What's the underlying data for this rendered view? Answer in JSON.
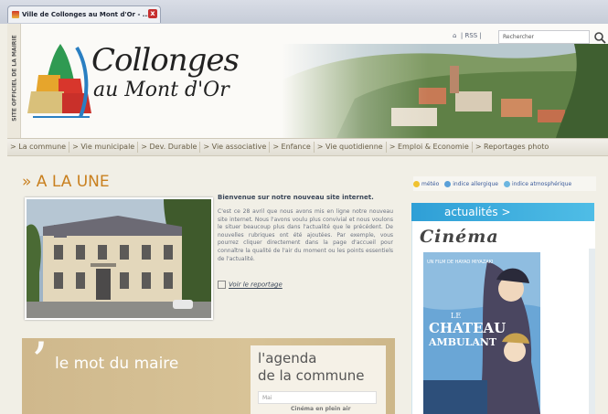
{
  "browser": {
    "tab_title": "Ville de Collonges au Mont d'Or - ...",
    "close_glyph": "x"
  },
  "header": {
    "vertical_label": "SITE OFFICIEL DE LA MAIRIE",
    "wordmark_line1": "Collonges",
    "wordmark_line2": "au Mont d'Or",
    "rss_label": "RSS",
    "search_placeholder": "Rechercher",
    "icons": [
      "home-icon",
      "search-icon"
    ]
  },
  "nav": {
    "items": [
      {
        "label": "> La commune"
      },
      {
        "label": "> Vie municipale"
      },
      {
        "label": "> Dev. Durable"
      },
      {
        "label": "> Vie associative"
      },
      {
        "label": "> Enfance"
      },
      {
        "label": "> Vie quotidienne"
      },
      {
        "label": "> Emploi & Economie"
      },
      {
        "label": "> Reportages photo"
      }
    ]
  },
  "main": {
    "section_title": "» A LA UNE",
    "welcome_title": "Bienvenue sur notre nouveau site internet.",
    "body": "C'est ce 28 avril que nous avons mis en ligne notre nouveau site internet. Nous l'avons voulu plus convivial et nous voulons le situer beaucoup plus dans l'actualité que le précédent. De nouvelles rubriques ont été ajoutées. Par exemple, vous pourrez cliquer directement dans la page d'accueil pour connaître la qualité de l'air du moment ou les points essentiels de l'actualité.",
    "link": "Voir le reportage"
  },
  "mot_du_maire": {
    "quote_glyph": "’",
    "title": "le mot du maire"
  },
  "agenda": {
    "title_line1": "l'agenda",
    "title_line2": "de la commune",
    "field_text": "Mai",
    "event": "Cinéma en plein air"
  },
  "sidebar": {
    "quick_links": [
      {
        "label": "météo",
        "icon": "sun-icon",
        "color": "#3a7fd0"
      },
      {
        "label": "indice allergique",
        "icon": "pollen-icon",
        "color": "#3a7fd0"
      },
      {
        "label": "indice atmosphérique",
        "icon": "air-icon",
        "color": "#3a7fd0"
      }
    ],
    "actu_tab": "actualités >",
    "cinema_title": "Cinéma",
    "poster": {
      "top": "UN FILM DE HAYAO MIYAZAKI",
      "title_line1": "LE",
      "title_line2": "CHATEAU",
      "title_line3": "AMBULANT"
    }
  },
  "colors": {
    "accent_orange": "#c9801f",
    "actu_blue": "#2f9fd6",
    "banner_tan": "#d2bd90"
  }
}
